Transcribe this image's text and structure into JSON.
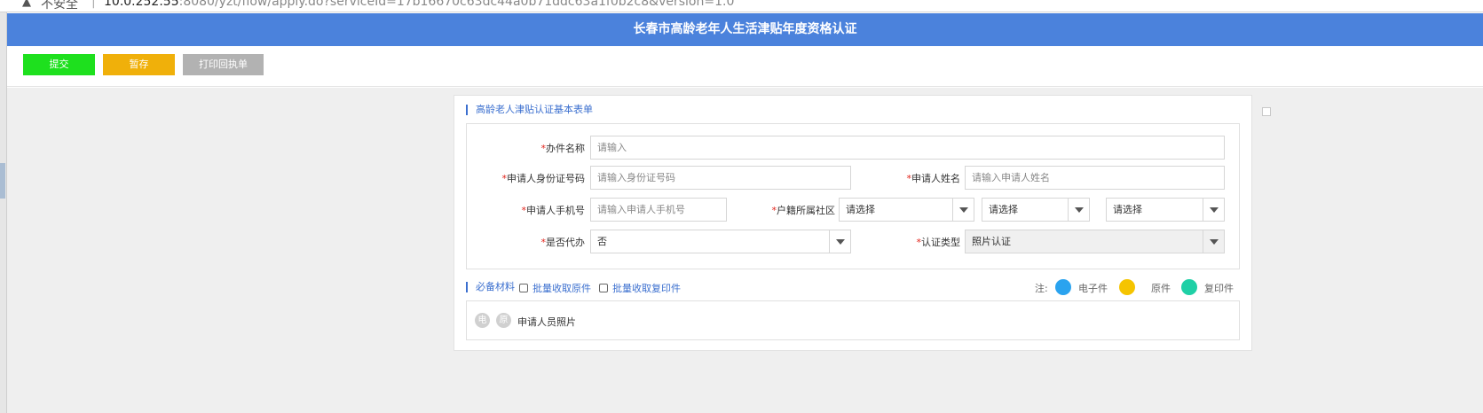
{
  "browser": {
    "security_label": "不安全",
    "separator": "|",
    "url_host": "10.0.252.55",
    "url_rest": ":8080/yzt/flow/apply.do?serviceId=17b16670c63dc44a0b71ddc63a1f0b2c8&version=1.0"
  },
  "header": {
    "title": "长春市高龄老年人生活津贴年度资格认证"
  },
  "toolbar": {
    "submit_label": "提交",
    "save_label": "暂存",
    "print_label": "打印回执单"
  },
  "form": {
    "section_title": "高龄老人津贴认证基本表单",
    "fields": {
      "case_name": {
        "label": "办件名称",
        "placeholder": "请输入"
      },
      "id_number": {
        "label": "申请人身份证号码",
        "placeholder": "请输入身份证号码"
      },
      "applicant_name": {
        "label": "申请人姓名",
        "placeholder": "请输入申请人姓名"
      },
      "phone": {
        "label": "申请人手机号",
        "placeholder": "请输入申请人手机号"
      },
      "community": {
        "label": "户籍所属社区",
        "select1": "请选择",
        "select2": "请选择",
        "select3": "请选择"
      },
      "proxy": {
        "label": "是否代办",
        "value": "否"
      },
      "cert_type": {
        "label": "认证类型",
        "value": "照片认证"
      }
    },
    "required_mark": "*"
  },
  "materials": {
    "section_title": "必备材料",
    "batch_original": "批量收取原件",
    "batch_copy": "批量收取复印件",
    "legend_note": "注:",
    "legend": [
      {
        "label": "电子件",
        "color": "#2aa3ef"
      },
      {
        "label": "原件",
        "color": "#f5c400"
      },
      {
        "label": "复印件",
        "color": "#1fd0a6"
      }
    ],
    "items": [
      {
        "badge_electronic": "电",
        "badge_original": "原",
        "name": "申请人员照片"
      }
    ]
  }
}
